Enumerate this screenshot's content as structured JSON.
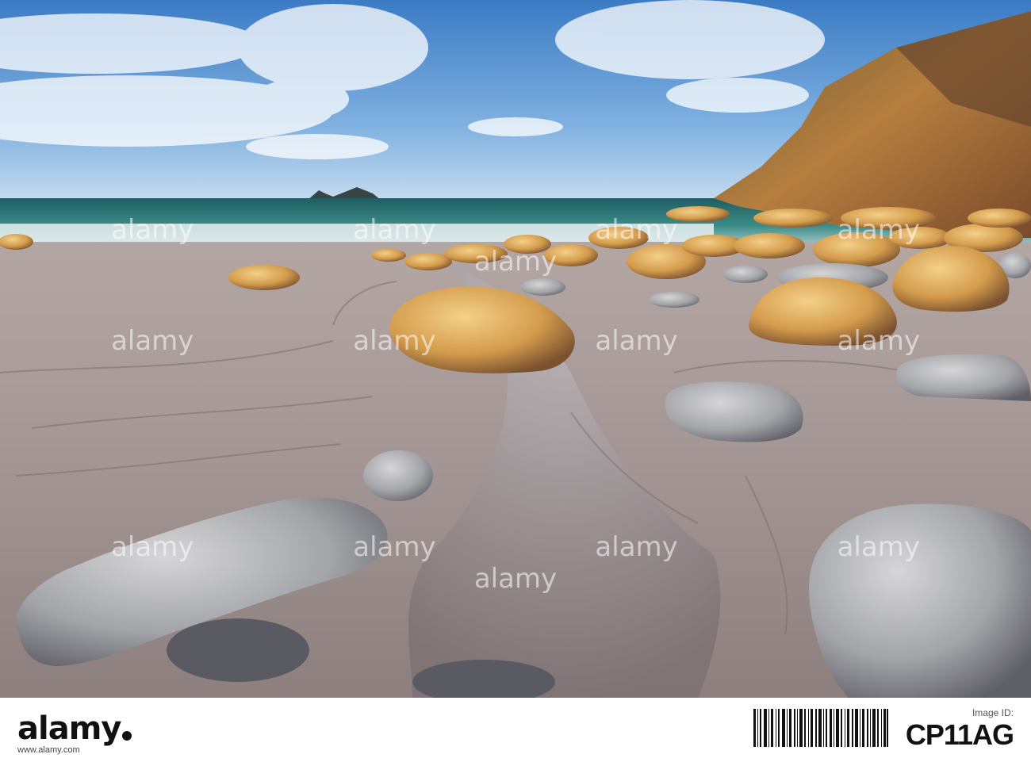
{
  "watermark": {
    "text": "alamy",
    "rows": [
      [
        "alamy",
        "alamy",
        "alamy",
        "alamy",
        "alamy"
      ],
      [
        "alamy",
        "alamy",
        "alamy",
        "alamy"
      ],
      [
        "alamy",
        "alamy",
        "alamy",
        "alamy",
        "alamy"
      ]
    ]
  },
  "footer": {
    "logo": "alamy",
    "url": "www.alamy.com",
    "image_id_label": "Image ID:",
    "image_id": "CP11AG"
  },
  "colors": {
    "sky_top": "#3f7fc6",
    "sea": "#2e7d78",
    "sand": "#a69a98",
    "boulder_gold": "#d9a75a",
    "boulder_grey": "#9a9da0",
    "cliff": "#8a6a3c"
  }
}
